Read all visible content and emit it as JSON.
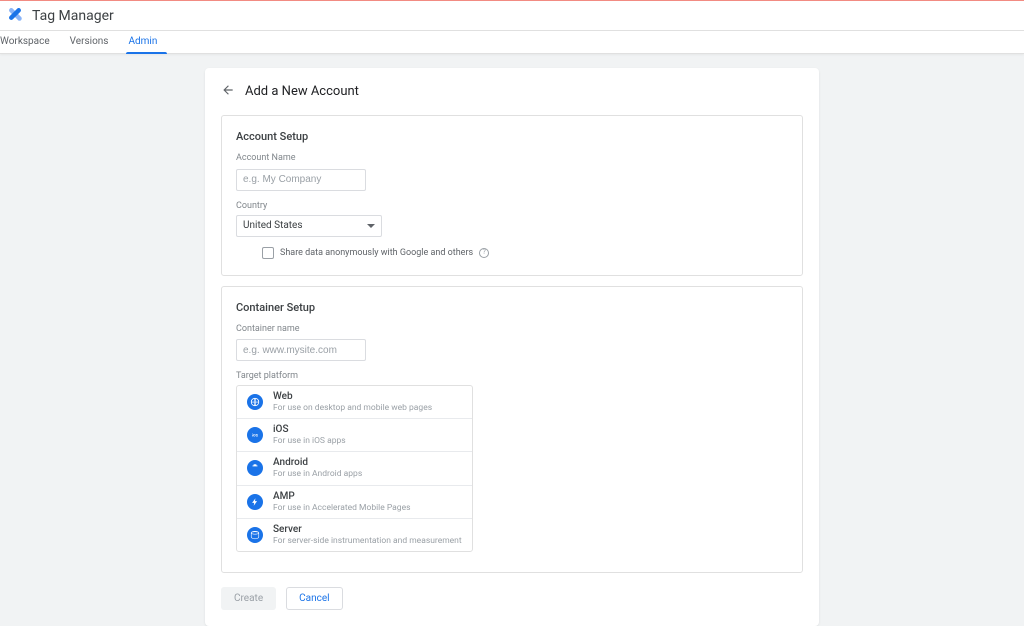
{
  "header": {
    "app_title": "Tag Manager"
  },
  "tabs": {
    "workspace": "Workspace",
    "versions": "Versions",
    "admin": "Admin"
  },
  "panel": {
    "title": "Add a New Account"
  },
  "account_setup": {
    "title": "Account Setup",
    "account_name_label": "Account Name",
    "account_name_placeholder": "e.g. My Company",
    "country_label": "Country",
    "country_value": "United States",
    "share_label": "Share data anonymously with Google and others"
  },
  "container_setup": {
    "title": "Container Setup",
    "container_name_label": "Container name",
    "container_name_placeholder": "e.g. www.mysite.com",
    "target_platform_label": "Target platform",
    "platforms": [
      {
        "name": "Web",
        "desc": "For use on desktop and mobile web pages",
        "color": "#1a73e8",
        "icon": "web"
      },
      {
        "name": "iOS",
        "desc": "For use in iOS apps",
        "color": "#1a73e8",
        "icon": "ios"
      },
      {
        "name": "Android",
        "desc": "For use in Android apps",
        "color": "#1a73e8",
        "icon": "android"
      },
      {
        "name": "AMP",
        "desc": "For use in Accelerated Mobile Pages",
        "color": "#1a73e8",
        "icon": "amp"
      },
      {
        "name": "Server",
        "desc": "For server-side instrumentation and measurement",
        "color": "#1a73e8",
        "icon": "server"
      }
    ]
  },
  "footer": {
    "create": "Create",
    "cancel": "Cancel"
  }
}
